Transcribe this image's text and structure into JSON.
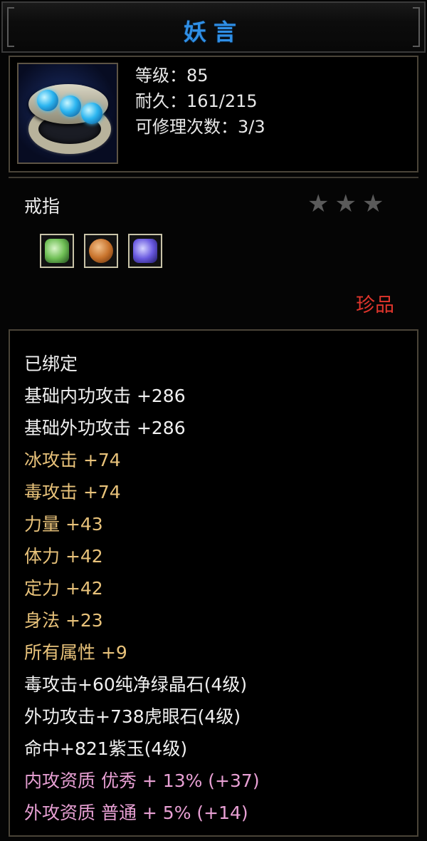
{
  "item": {
    "name": "妖言",
    "title_color": "#2f8fe6",
    "level_line": "等级：85",
    "durability_line": "耐久：161/215",
    "repair_line": "可修理次数：3/3",
    "icon": "ring-with-blue-gems-icon",
    "type": "戒指",
    "stars": "★★★",
    "rarity": "珍品",
    "rarity_color": "#e0352c",
    "sockets": [
      {
        "icon": "green-gem-icon",
        "color": "#6fbf55"
      },
      {
        "icon": "amber-gem-icon",
        "color": "#c8732c"
      },
      {
        "icon": "purple-gem-icon",
        "color": "#6a5ae0"
      }
    ]
  },
  "attributes": [
    {
      "text": "已绑定",
      "tone": "white"
    },
    {
      "text": "基础内功攻击 +286",
      "tone": "white"
    },
    {
      "text": "基础外功攻击 +286",
      "tone": "white"
    },
    {
      "text": "冰攻击 +74",
      "tone": "yellow"
    },
    {
      "text": "毒攻击 +74",
      "tone": "yellow"
    },
    {
      "text": "力量 +43",
      "tone": "yellow"
    },
    {
      "text": "体力 +42",
      "tone": "yellow"
    },
    {
      "text": "定力 +42",
      "tone": "yellow"
    },
    {
      "text": "身法 +23",
      "tone": "yellow"
    },
    {
      "text": "所有属性 +9",
      "tone": "yellow"
    },
    {
      "text": "毒攻击+60纯净绿晶石(4级)",
      "tone": "white"
    },
    {
      "text": "外功攻击+738虎眼石(4级)",
      "tone": "white"
    },
    {
      "text": "命中+821紫玉(4级)",
      "tone": "white"
    },
    {
      "text": "内攻资质 优秀 + 13% (+37)",
      "tone": "pink"
    },
    {
      "text": "外攻资质 普通 + 5% (+14)",
      "tone": "pink"
    }
  ],
  "colors": {
    "white": "#f0f0f0",
    "yellow": "#e8c27a",
    "pink": "#e8a0d4"
  }
}
